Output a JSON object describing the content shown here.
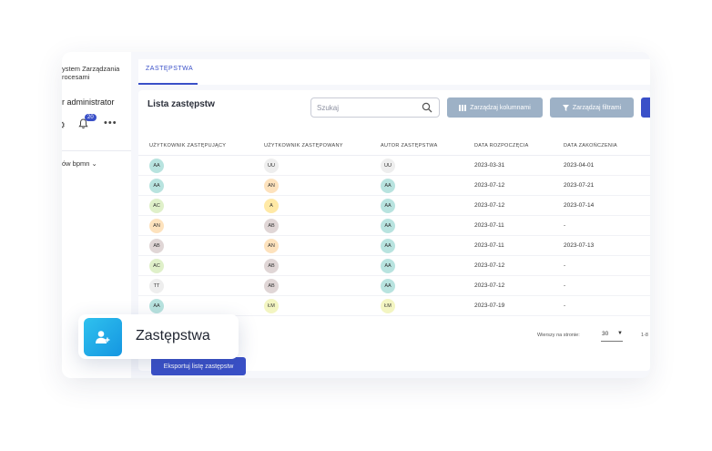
{
  "sidebar": {
    "system_title_line1": "ystem Zarządzania",
    "system_title_line2": "rocesami",
    "admin_label": "r administrator",
    "notifications_count": "20",
    "processes_label": "ów bpmn"
  },
  "tabs": [
    {
      "label": "ZASTĘPSTWA"
    }
  ],
  "card": {
    "title": "Lista zastępstw",
    "search_placeholder": "Szukaj",
    "manage_columns_label": "Zarządzaj kolumnami",
    "manage_filters_label": "Zarządzaj filtrami"
  },
  "columns": {
    "substitute": "UŻYTKOWNIK ZASTĘPUJĄCY",
    "substituted": "UŻYTKOWNIK ZASTĘPOWANY",
    "author": "AUTOR ZASTĘPSTWA",
    "start": "DATA ROZPOCZĘCIA",
    "end": "DATA ZAKOŃCZENIA"
  },
  "rows": [
    {
      "substitute": "AA",
      "substituted": "UU",
      "author": "UU",
      "start": "2023-03-31",
      "end": "2023-04-01"
    },
    {
      "substitute": "AA",
      "substituted": "AN",
      "author": "AA",
      "start": "2023-07-12",
      "end": "2023-07-21"
    },
    {
      "substitute": "AC",
      "substituted": "A",
      "author": "AA",
      "start": "2023-07-12",
      "end": "2023-07-14"
    },
    {
      "substitute": "AN",
      "substituted": "AB",
      "author": "AA",
      "start": "2023-07-11",
      "end": "-"
    },
    {
      "substitute": "AB",
      "substituted": "AN",
      "author": "AA",
      "start": "2023-07-11",
      "end": "2023-07-13"
    },
    {
      "substitute": "AC",
      "substituted": "AB",
      "author": "AA",
      "start": "2023-07-12",
      "end": "-"
    },
    {
      "substitute": "TT",
      "substituted": "AB",
      "author": "AA",
      "start": "2023-07-12",
      "end": "-"
    },
    {
      "substitute": "AA",
      "substituted": "ŁM",
      "author": "ŁM",
      "start": "2023-07-19",
      "end": "-"
    }
  ],
  "avatar_colors": {
    "AA": "#b8e3df",
    "UU": "#eeeeee",
    "AN": "#fde2bd",
    "AC": "#dff0c9",
    "A": "#ffe9a6",
    "AB": "#e0d6d6",
    "TT": "#eeeeee",
    "ŁM": "#f3f5c2"
  },
  "pagination": {
    "rows_per_page_label": "Wierszy na stronie:",
    "rows_per_page": "30",
    "range": "1-8"
  },
  "export_label": "Eksportuj listę zastępstw",
  "overlay": {
    "label": "Zastępstwa",
    "icon": "user-plus-icon"
  },
  "colors": {
    "accent": "#3a50c8",
    "muted_button": "#9db1c6",
    "overlay_icon": "#1aa6e8"
  }
}
